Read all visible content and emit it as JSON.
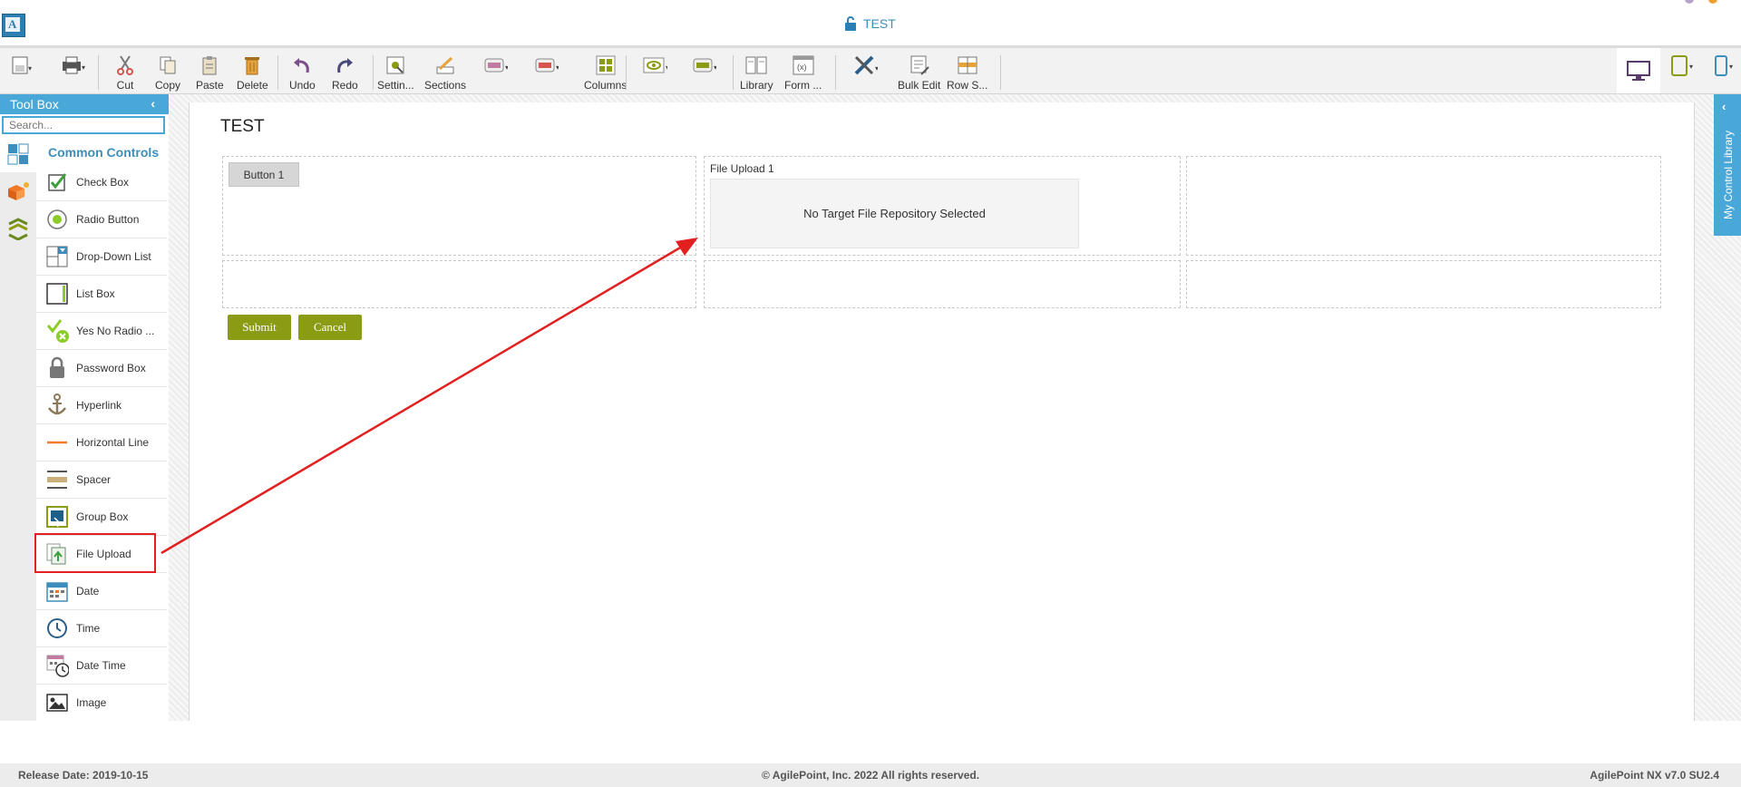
{
  "titlebar": {
    "title": "TEST"
  },
  "toolbar": {
    "cut": "Cut",
    "copy": "Copy",
    "paste": "Paste",
    "delete": "Delete",
    "undo": "Undo",
    "redo": "Redo",
    "settings": "Settin...",
    "sections": "Sections",
    "columns": "Columns",
    "library": "Library",
    "form": "Form ...",
    "bulk_edit": "Bulk Edit",
    "row": "Row S..."
  },
  "toolbox": {
    "title": "Tool Box",
    "search_placeholder": "Search...",
    "section_title": "Common Controls",
    "items": [
      {
        "label": "Check Box",
        "icon": "checkbox-icon"
      },
      {
        "label": "Radio Button",
        "icon": "radio-button-icon"
      },
      {
        "label": "Drop-Down List",
        "icon": "dropdown-list-icon"
      },
      {
        "label": "List Box",
        "icon": "list-box-icon"
      },
      {
        "label": "Yes No Radio ...",
        "icon": "yes-no-icon"
      },
      {
        "label": "Password Box",
        "icon": "lock-icon"
      },
      {
        "label": "Hyperlink",
        "icon": "anchor-icon"
      },
      {
        "label": "Horizontal Line",
        "icon": "horizontal-line-icon"
      },
      {
        "label": "Spacer",
        "icon": "spacer-icon"
      },
      {
        "label": "Group Box",
        "icon": "group-box-icon"
      },
      {
        "label": "File Upload",
        "icon": "file-upload-icon"
      },
      {
        "label": "Date",
        "icon": "calendar-icon"
      },
      {
        "label": "Time",
        "icon": "clock-icon"
      },
      {
        "label": "Date Time",
        "icon": "date-time-icon"
      },
      {
        "label": "Image",
        "icon": "image-icon"
      }
    ]
  },
  "form": {
    "title": "TEST",
    "button1": "Button 1",
    "file_upload_label": "File Upload 1",
    "file_upload_message": "No Target File Repository Selected",
    "submit": "Submit",
    "cancel": "Cancel"
  },
  "library_tab": {
    "label": "My Control Library"
  },
  "footer": {
    "release": "Release Date: 2019-10-15",
    "copyright": "© AgilePoint, Inc. 2022 All rights reserved.",
    "version": "AgilePoint NX v7.0 SU2.4"
  },
  "colors": {
    "accent": "#4aa8d8",
    "form_button": "#8c9b14",
    "annotation": "#e32020"
  }
}
